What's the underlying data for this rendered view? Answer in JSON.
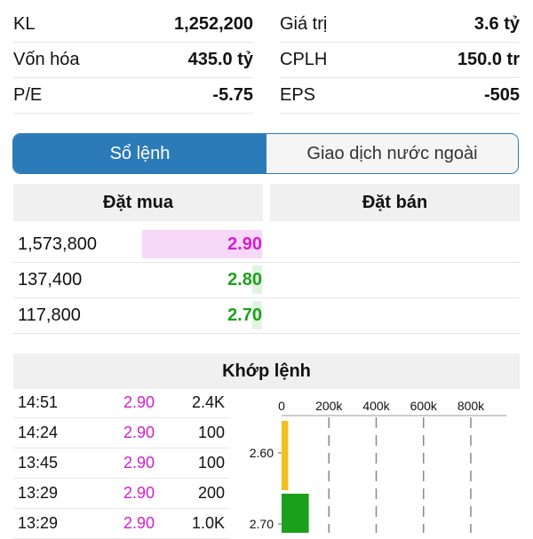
{
  "stats": {
    "left": [
      {
        "label": "KL",
        "value": "1,252,200"
      },
      {
        "label": "Vốn hóa",
        "value": "435.0 tỷ"
      },
      {
        "label": "P/E",
        "value": "-5.75"
      }
    ],
    "right": [
      {
        "label": "Giá trị",
        "value": "3.6 tỷ"
      },
      {
        "label": "CPLH",
        "value": "150.0 tr"
      },
      {
        "label": "EPS",
        "value": "-505"
      }
    ]
  },
  "tabs": {
    "active": "Sổ lệnh",
    "inactive": "Giao dịch nước ngoài"
  },
  "order_book": {
    "buy_header": "Đặt mua",
    "sell_header": "Đặt bán",
    "buy_orders": [
      {
        "volume": "1,573,800",
        "price": "2.90",
        "price_color": "#d020d0",
        "bar_color": "#f8d8f8",
        "fill": 0.24
      },
      {
        "volume": "137,400",
        "price": "2.80",
        "price_color": "#20a020",
        "bar_color": "#e0f5e0",
        "fill": 0.02
      },
      {
        "volume": "117,800",
        "price": "2.70",
        "price_color": "#20a020",
        "bar_color": "#e0f5e0",
        "fill": 0.02
      }
    ]
  },
  "matches": {
    "title": "Khớp lệnh",
    "rows": [
      {
        "time": "14:51",
        "price": "2.90",
        "volume": "2.4K"
      },
      {
        "time": "14:24",
        "price": "2.90",
        "volume": "100"
      },
      {
        "time": "13:45",
        "price": "2.90",
        "volume": "100"
      },
      {
        "time": "13:29",
        "price": "2.90",
        "volume": "200"
      },
      {
        "time": "13:29",
        "price": "2.90",
        "volume": "1.0K"
      }
    ]
  },
  "chart_data": {
    "type": "bar",
    "orientation": "horizontal",
    "x_ticks": [
      "0",
      "200k",
      "400k",
      "600k",
      "800k"
    ],
    "xlim": [
      0,
      800000
    ],
    "grid": true,
    "categories": [
      "2.60",
      "2.70"
    ],
    "values": [
      28000,
      115000
    ],
    "colors": [
      "#f0c020",
      "#1aa01a"
    ]
  }
}
